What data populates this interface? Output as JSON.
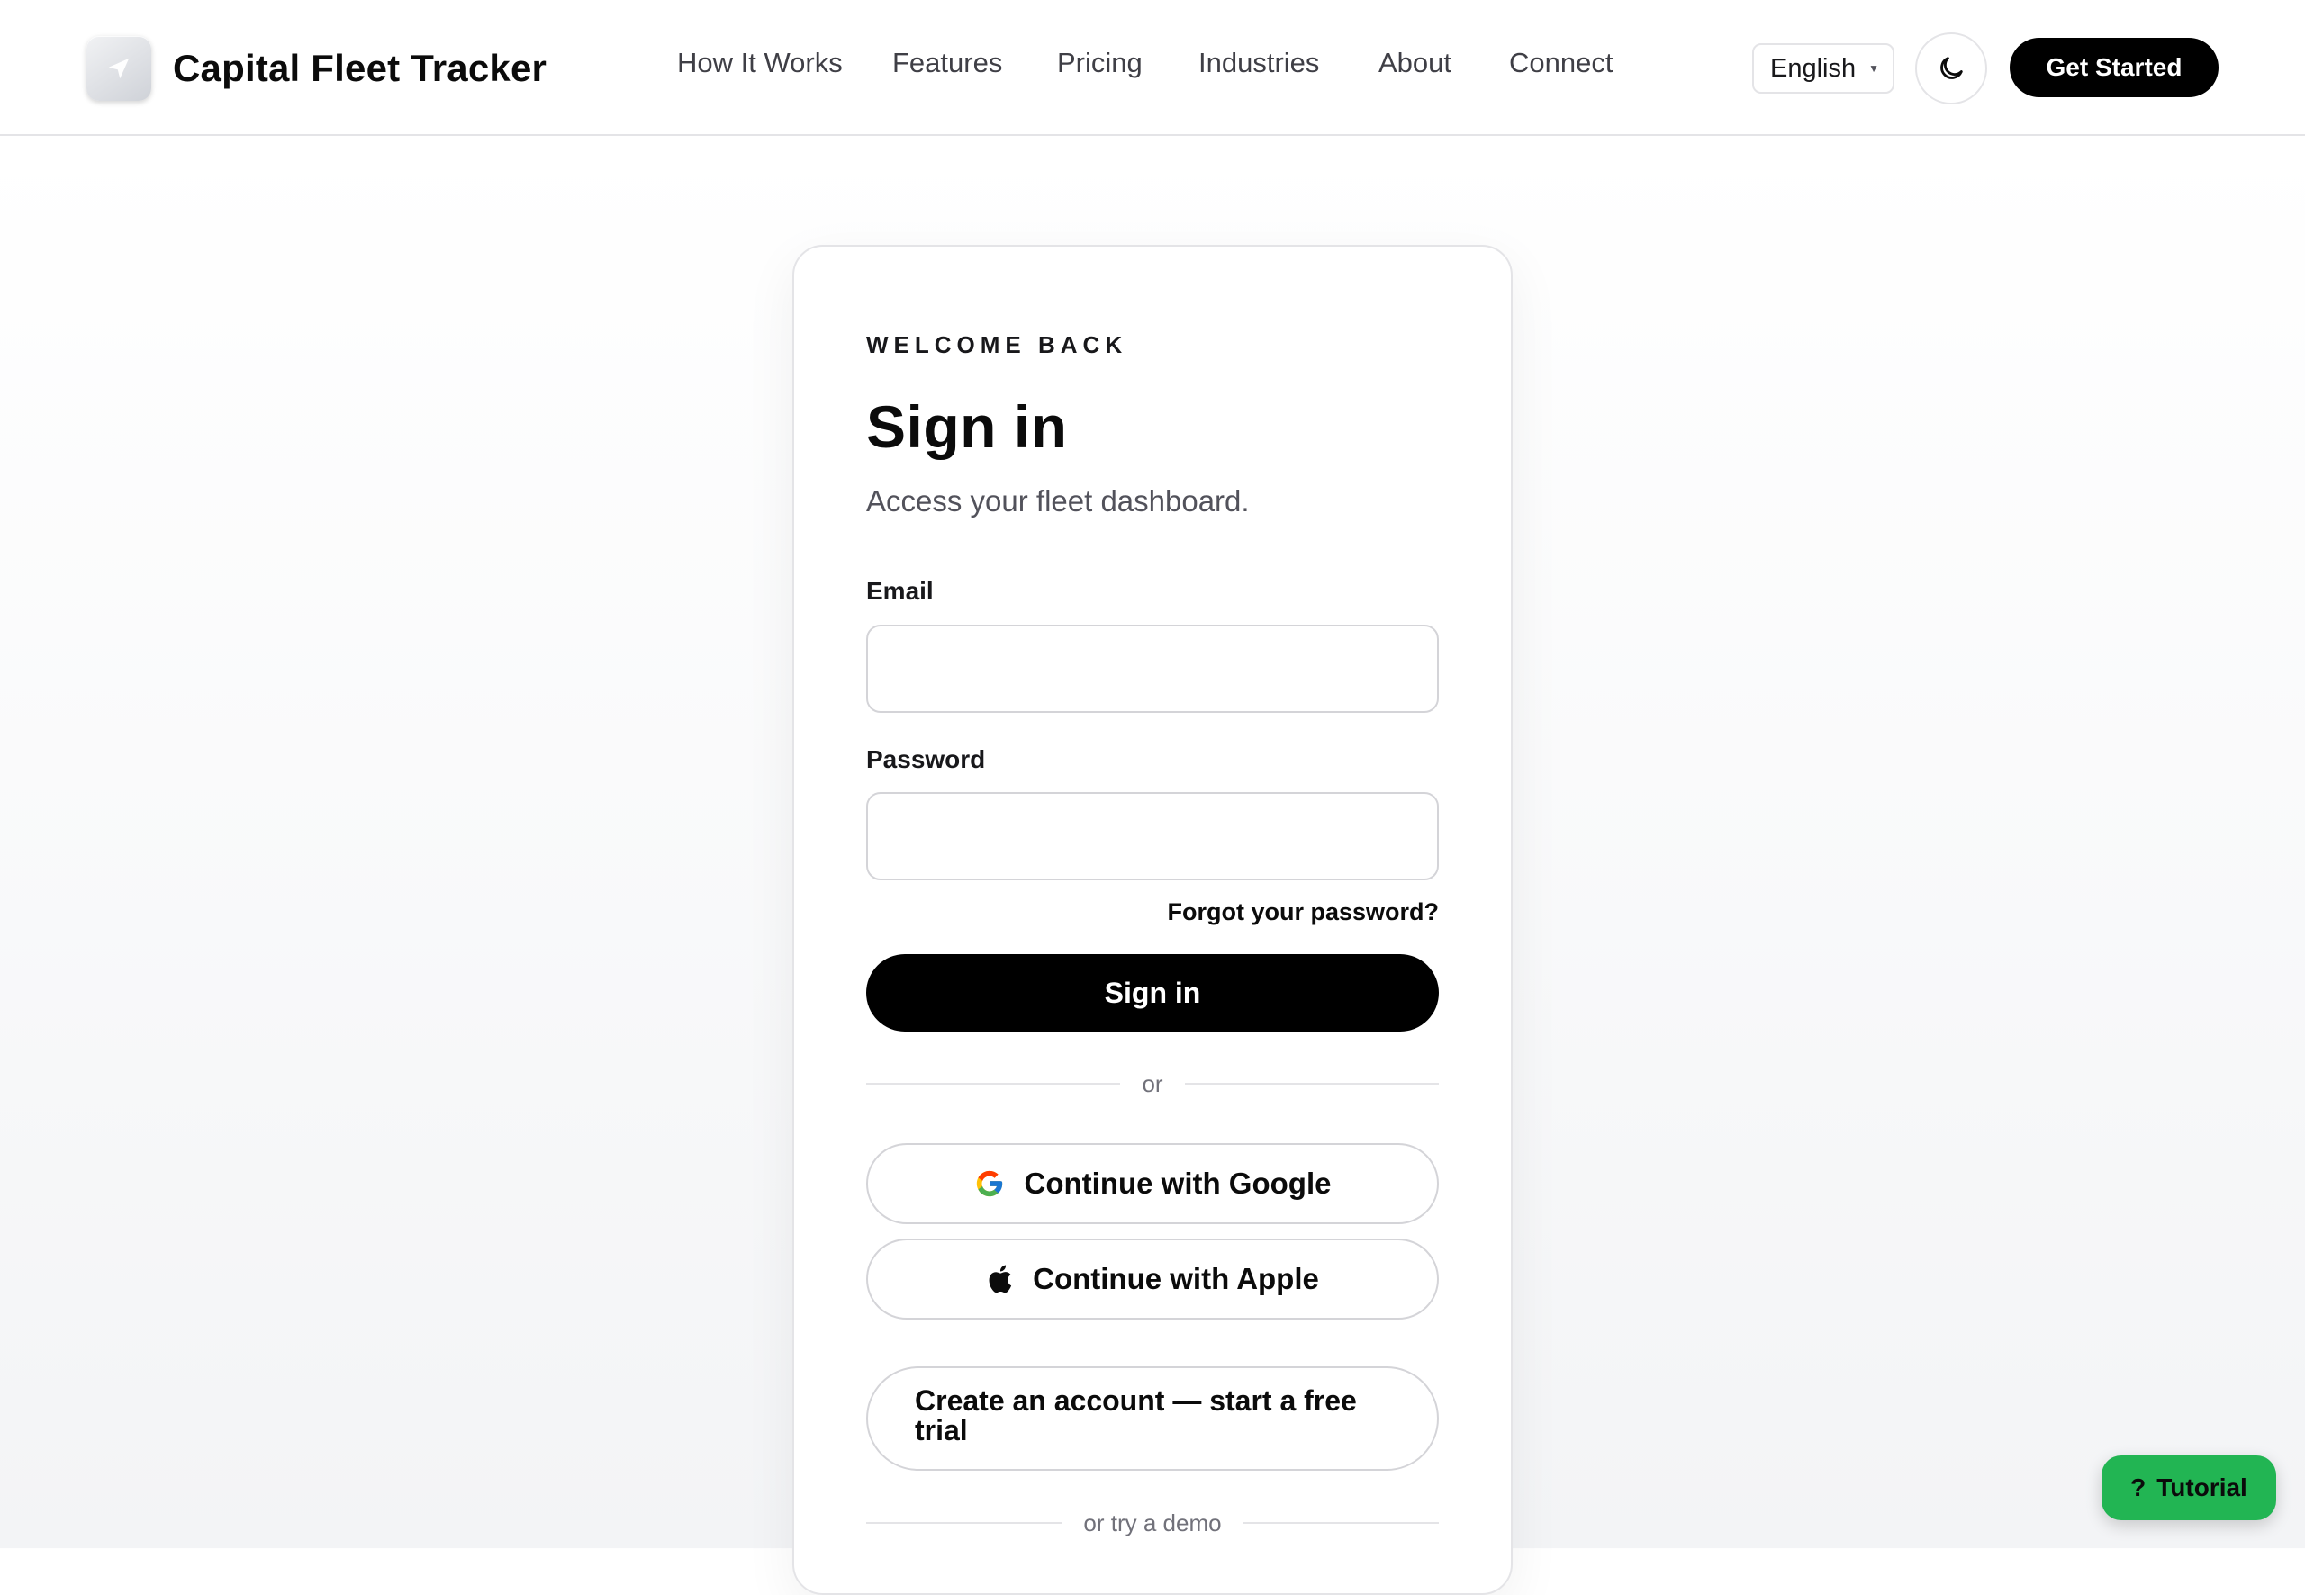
{
  "header": {
    "brand_name": "Capital Fleet Tracker",
    "nav": [
      "How It Works",
      "Features",
      "Pricing",
      "Industries",
      "About",
      "Connect"
    ],
    "language": "English",
    "get_started_label": "Get Started"
  },
  "signin": {
    "eyebrow": "WELCOME BACK",
    "title": "Sign in",
    "subtitle": "Access your fleet dashboard.",
    "email_label": "Email",
    "email_value": "",
    "password_label": "Password",
    "password_value": "",
    "forgot_label": "Forgot your password?",
    "submit_label": "Sign in",
    "divider_or": "or",
    "google_label": "Continue with Google",
    "apple_label": "Continue with Apple",
    "create_account_label": "Create an account — start a free trial",
    "demo_divider": "or try a demo"
  },
  "tutorial": {
    "icon": "?",
    "label": "Tutorial"
  },
  "colors": {
    "primary": "#000000",
    "tutorial_green": "#22b553",
    "border": "#e4e4e7"
  },
  "icons": [
    "navigation-arrow-icon",
    "chevron-down-icon",
    "moon-icon",
    "google-icon",
    "apple-icon",
    "help-icon"
  ]
}
